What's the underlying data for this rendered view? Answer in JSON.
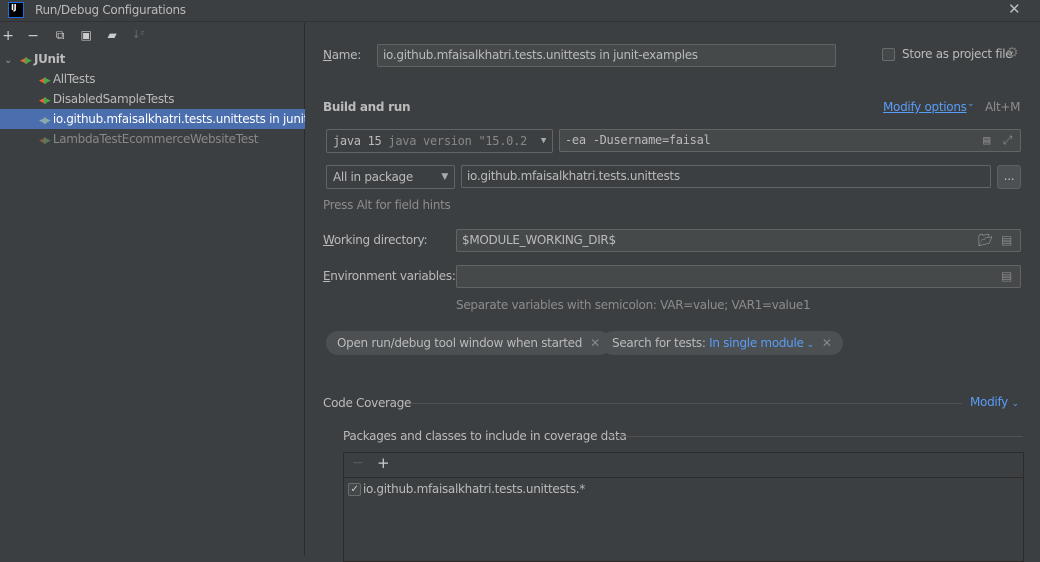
{
  "window": {
    "title": "Run/Debug Configurations",
    "logo": "IJ"
  },
  "toolbar": {
    "icons": [
      "plus-icon",
      "minus-icon",
      "copy-icon",
      "save-icon",
      "new-folder-icon",
      "sort-icon"
    ]
  },
  "tree": {
    "root": "JUnit",
    "items": [
      {
        "label": "AllTests",
        "selected": false,
        "dimmed": false
      },
      {
        "label": "DisabledSampleTests",
        "selected": false,
        "dimmed": false
      },
      {
        "label": "io.github.mfaisalkhatri.tests.unittests in junit-examples",
        "selected": true,
        "dimmed": false
      },
      {
        "label": "LambdaTestEcommerceWebsiteTest",
        "selected": false,
        "dimmed": true
      }
    ]
  },
  "form": {
    "name_label": "Name:",
    "name_value": "io.github.mfaisalkhatri.tests.unittests in junit-examples",
    "store_label": "Store as project file",
    "store_checked": false,
    "build_run": "Build and run",
    "modify_options": "Modify options",
    "modify_shortcut": "Alt+M",
    "jre_main": "java 15",
    "jre_detail": "java version \"15.0.2",
    "vm_options": "-ea -Dusername=faisal",
    "test_kind": "All in package",
    "package_value": "io.github.mfaisalkhatri.tests.unittests",
    "browse_label": "...",
    "alt_hint": "Press Alt for field hints",
    "workdir_label": "Working directory:",
    "workdir_value": "$MODULE_WORKING_DIR$",
    "env_label": "Environment variables:",
    "env_value": "",
    "env_hint": "Separate variables with semicolon: VAR=value; VAR1=value1",
    "chip1": "Open run/debug tool window when started",
    "chip2_label": "Search for tests:",
    "chip2_value": "In single module"
  },
  "coverage": {
    "title": "Code Coverage",
    "modify": "Modify",
    "packages_title": "Packages and classes to include in coverage data",
    "entries": [
      {
        "pattern": "io.github.mfaisalkhatri.tests.unittests.*",
        "checked": true
      }
    ]
  },
  "colors": {
    "background": "#3c3f41",
    "selection": "#4b6eaf",
    "link": "#589df6"
  }
}
